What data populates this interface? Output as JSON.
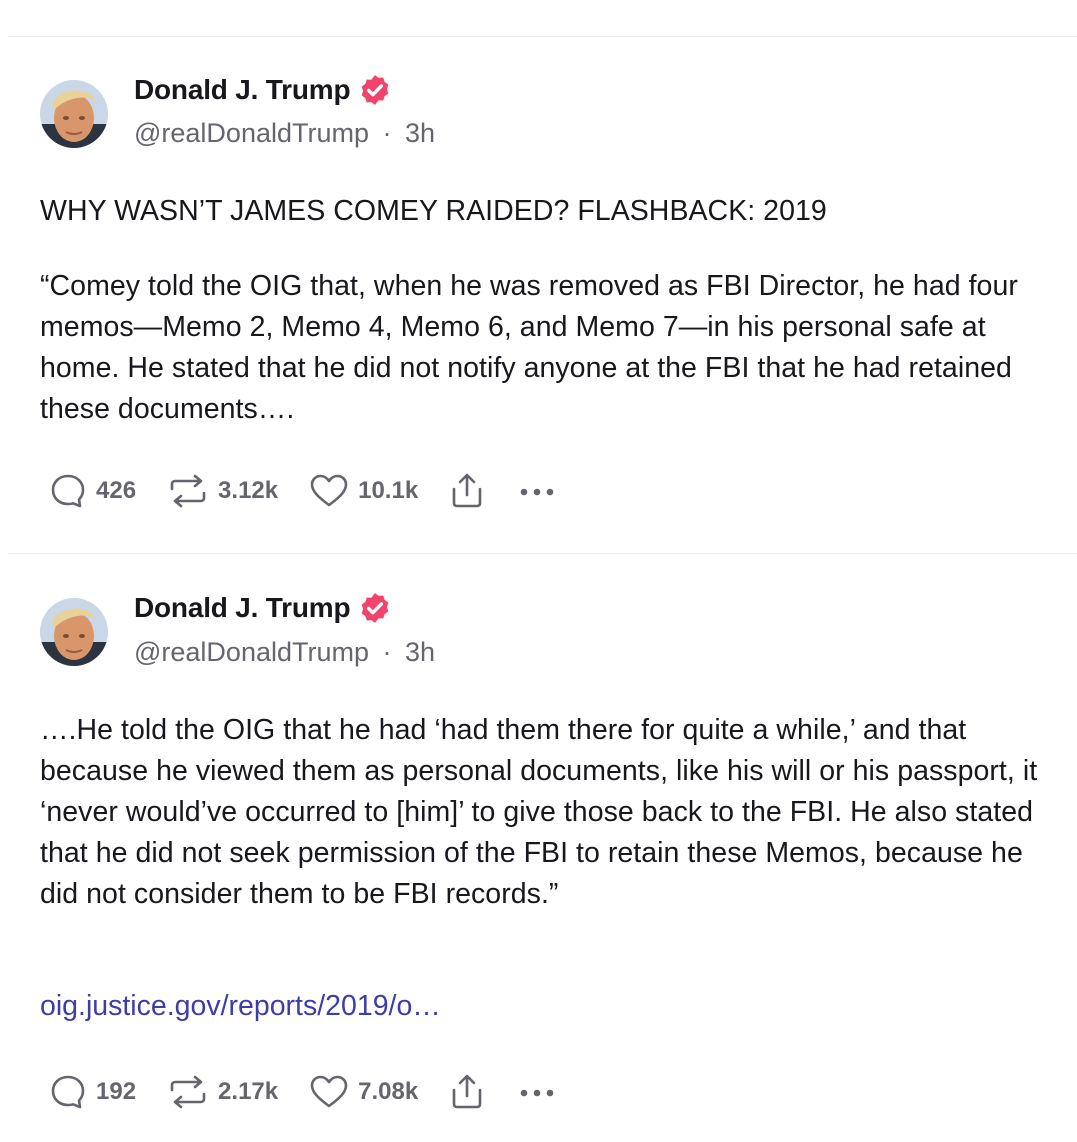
{
  "posts": [
    {
      "author": {
        "name": "Donald J. Trump",
        "handle": "@realDonaldTrump",
        "time": "3h",
        "avatar_icon": "avatar-photo",
        "verified_icon": "verified-badge-icon"
      },
      "paragraphs": [
        "WHY WASN’T JAMES COMEY RAIDED? FLASHBACK: 2019",
        "“Comey told the OIG that, when he was removed as FBI Director, he had four memos—Memo 2, Memo 4, Memo 6, and Memo 7—in his personal safe at home. He stated that he did not notify anyone at the FBI that he had retained these documents…."
      ],
      "link": "",
      "replies": "426",
      "reposts": "3.12k",
      "likes": "10.1k"
    },
    {
      "author": {
        "name": "Donald J. Trump",
        "handle": "@realDonaldTrump",
        "time": "3h",
        "avatar_icon": "avatar-photo",
        "verified_icon": "verified-badge-icon"
      },
      "paragraphs": [
        "….He told the OIG that he had ‘had them there for quite a while,’ and that because he viewed them as personal documents, like his will or his passport, it ‘never would’ve occurred to [him]’ to give those back to the FBI. He also stated that he did not seek permission of the FBI to retain these Memos, because he did not consider them to be FBI records.”"
      ],
      "link": "oig.justice.gov/reports/2019/o…",
      "replies": "192",
      "reposts": "2.17k",
      "likes": "7.08k"
    }
  ],
  "separator": "·",
  "colors": {
    "text": "#17171d",
    "muted": "#65656e",
    "link": "#3d3da8",
    "verified": "#f2436a",
    "divider": "#ececf0"
  }
}
